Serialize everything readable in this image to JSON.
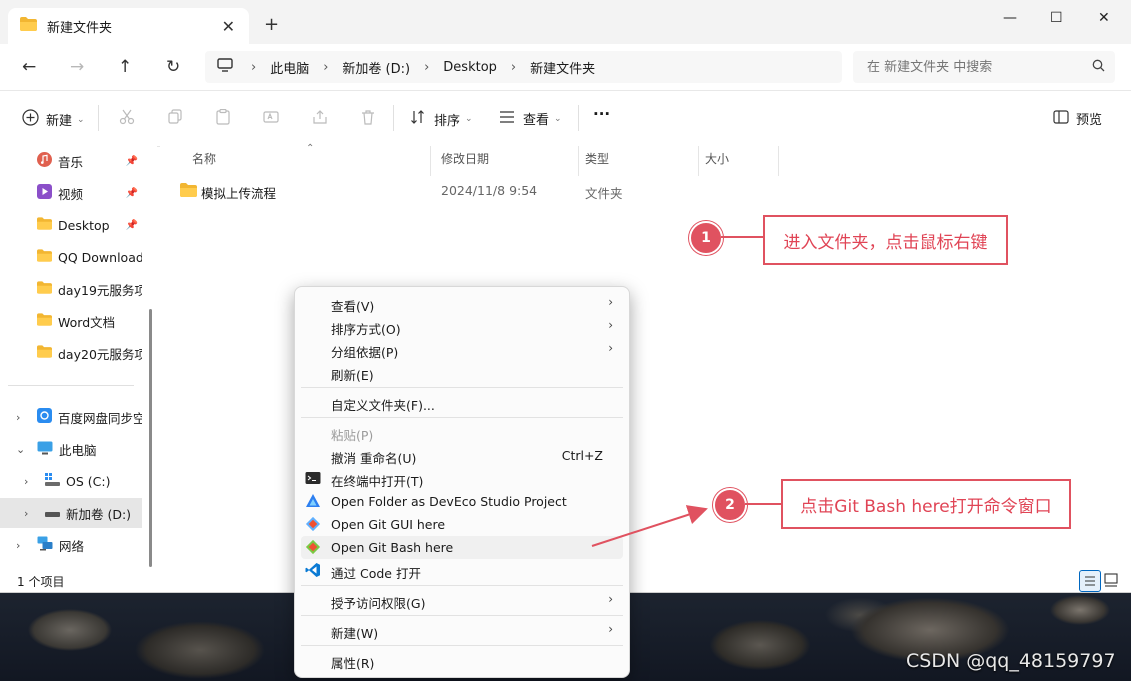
{
  "window": {
    "tab_title": "新建文件夹",
    "new_tab": "+",
    "minimize": "—",
    "maximize": "☐",
    "close": "✕"
  },
  "address": {
    "crumbs": [
      "此电脑",
      "新加卷 (D:)",
      "Desktop",
      "新建文件夹"
    ],
    "separator": "›",
    "search_placeholder": "在 新建文件夹 中搜索"
  },
  "toolbar": {
    "new_label": "新建",
    "sort_label": "排序",
    "view_label": "查看",
    "more": "···",
    "preview_label": "预览"
  },
  "sidebar": {
    "quick": [
      {
        "label": "音乐"
      },
      {
        "label": "视频"
      },
      {
        "label": "Desktop"
      },
      {
        "label": "QQ Download"
      },
      {
        "label": "day19元服务项"
      },
      {
        "label": "Word文档"
      },
      {
        "label": "day20元服务项"
      }
    ],
    "tree": [
      {
        "label": "百度网盘同步空"
      },
      {
        "label": "此电脑"
      },
      {
        "label": "OS (C:)"
      },
      {
        "label": "新加卷 (D:)"
      },
      {
        "label": "网络"
      }
    ]
  },
  "content": {
    "columns": [
      "名称",
      "修改日期",
      "类型",
      "大小"
    ],
    "rows": [
      {
        "name": "模拟上传流程",
        "modified": "2024/11/8 9:54",
        "type": "文件夹",
        "size": ""
      }
    ]
  },
  "status": {
    "count": "1 个项目"
  },
  "context_menu": {
    "items": [
      {
        "label": "查看(V)",
        "submenu": true
      },
      {
        "label": "排序方式(O)",
        "submenu": true
      },
      {
        "label": "分组依据(P)",
        "submenu": true
      },
      {
        "label": "刷新(E)"
      },
      {
        "label": "自定义文件夹(F)..."
      },
      {
        "label": "粘贴(P)",
        "disabled": true
      },
      {
        "label": "撤消 重命名(U)",
        "shortcut": "Ctrl+Z"
      },
      {
        "label": "在终端中打开(T)",
        "icon": "terminal-icon"
      },
      {
        "label": "Open Folder as DevEco Studio Project",
        "icon": "deveco-icon"
      },
      {
        "label": "Open Git GUI here",
        "icon": "git-gui-icon"
      },
      {
        "label": "Open Git Bash here",
        "icon": "git-bash-icon"
      },
      {
        "label": "通过 Code 打开",
        "icon": "vscode-icon"
      },
      {
        "label": "授予访问权限(G)",
        "submenu": true
      },
      {
        "label": "新建(W)",
        "submenu": true
      },
      {
        "label": "属性(R)"
      }
    ],
    "arrow": "›"
  },
  "annotations": [
    {
      "number": "1",
      "text": "进入文件夹，点击鼠标右键"
    },
    {
      "number": "2",
      "text": "点击Git Bash here打开命令窗口"
    }
  ],
  "watermark": "CSDN @qq_48159797",
  "colors": {
    "annotation": "#e05260",
    "accent": "#0067c0"
  }
}
